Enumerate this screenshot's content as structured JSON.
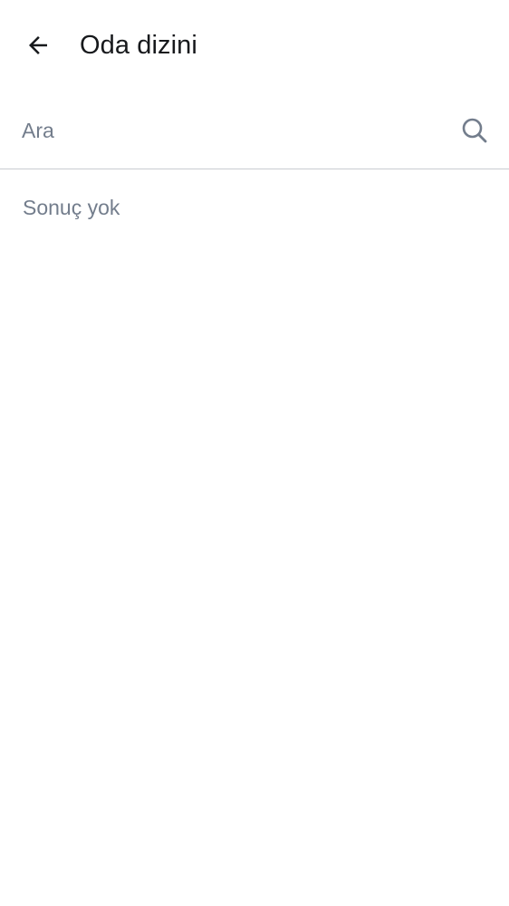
{
  "header": {
    "title": "Oda dizini",
    "back_icon": "arrow-left-icon"
  },
  "search": {
    "placeholder": "Ara",
    "value": "",
    "icon": "search-icon"
  },
  "results": {
    "empty_message": "Sonuç yok"
  },
  "colors": {
    "primary_text": "#17191c",
    "secondary_text": "#737d8c",
    "divider": "#c9ccd1",
    "background": "#ffffff"
  }
}
